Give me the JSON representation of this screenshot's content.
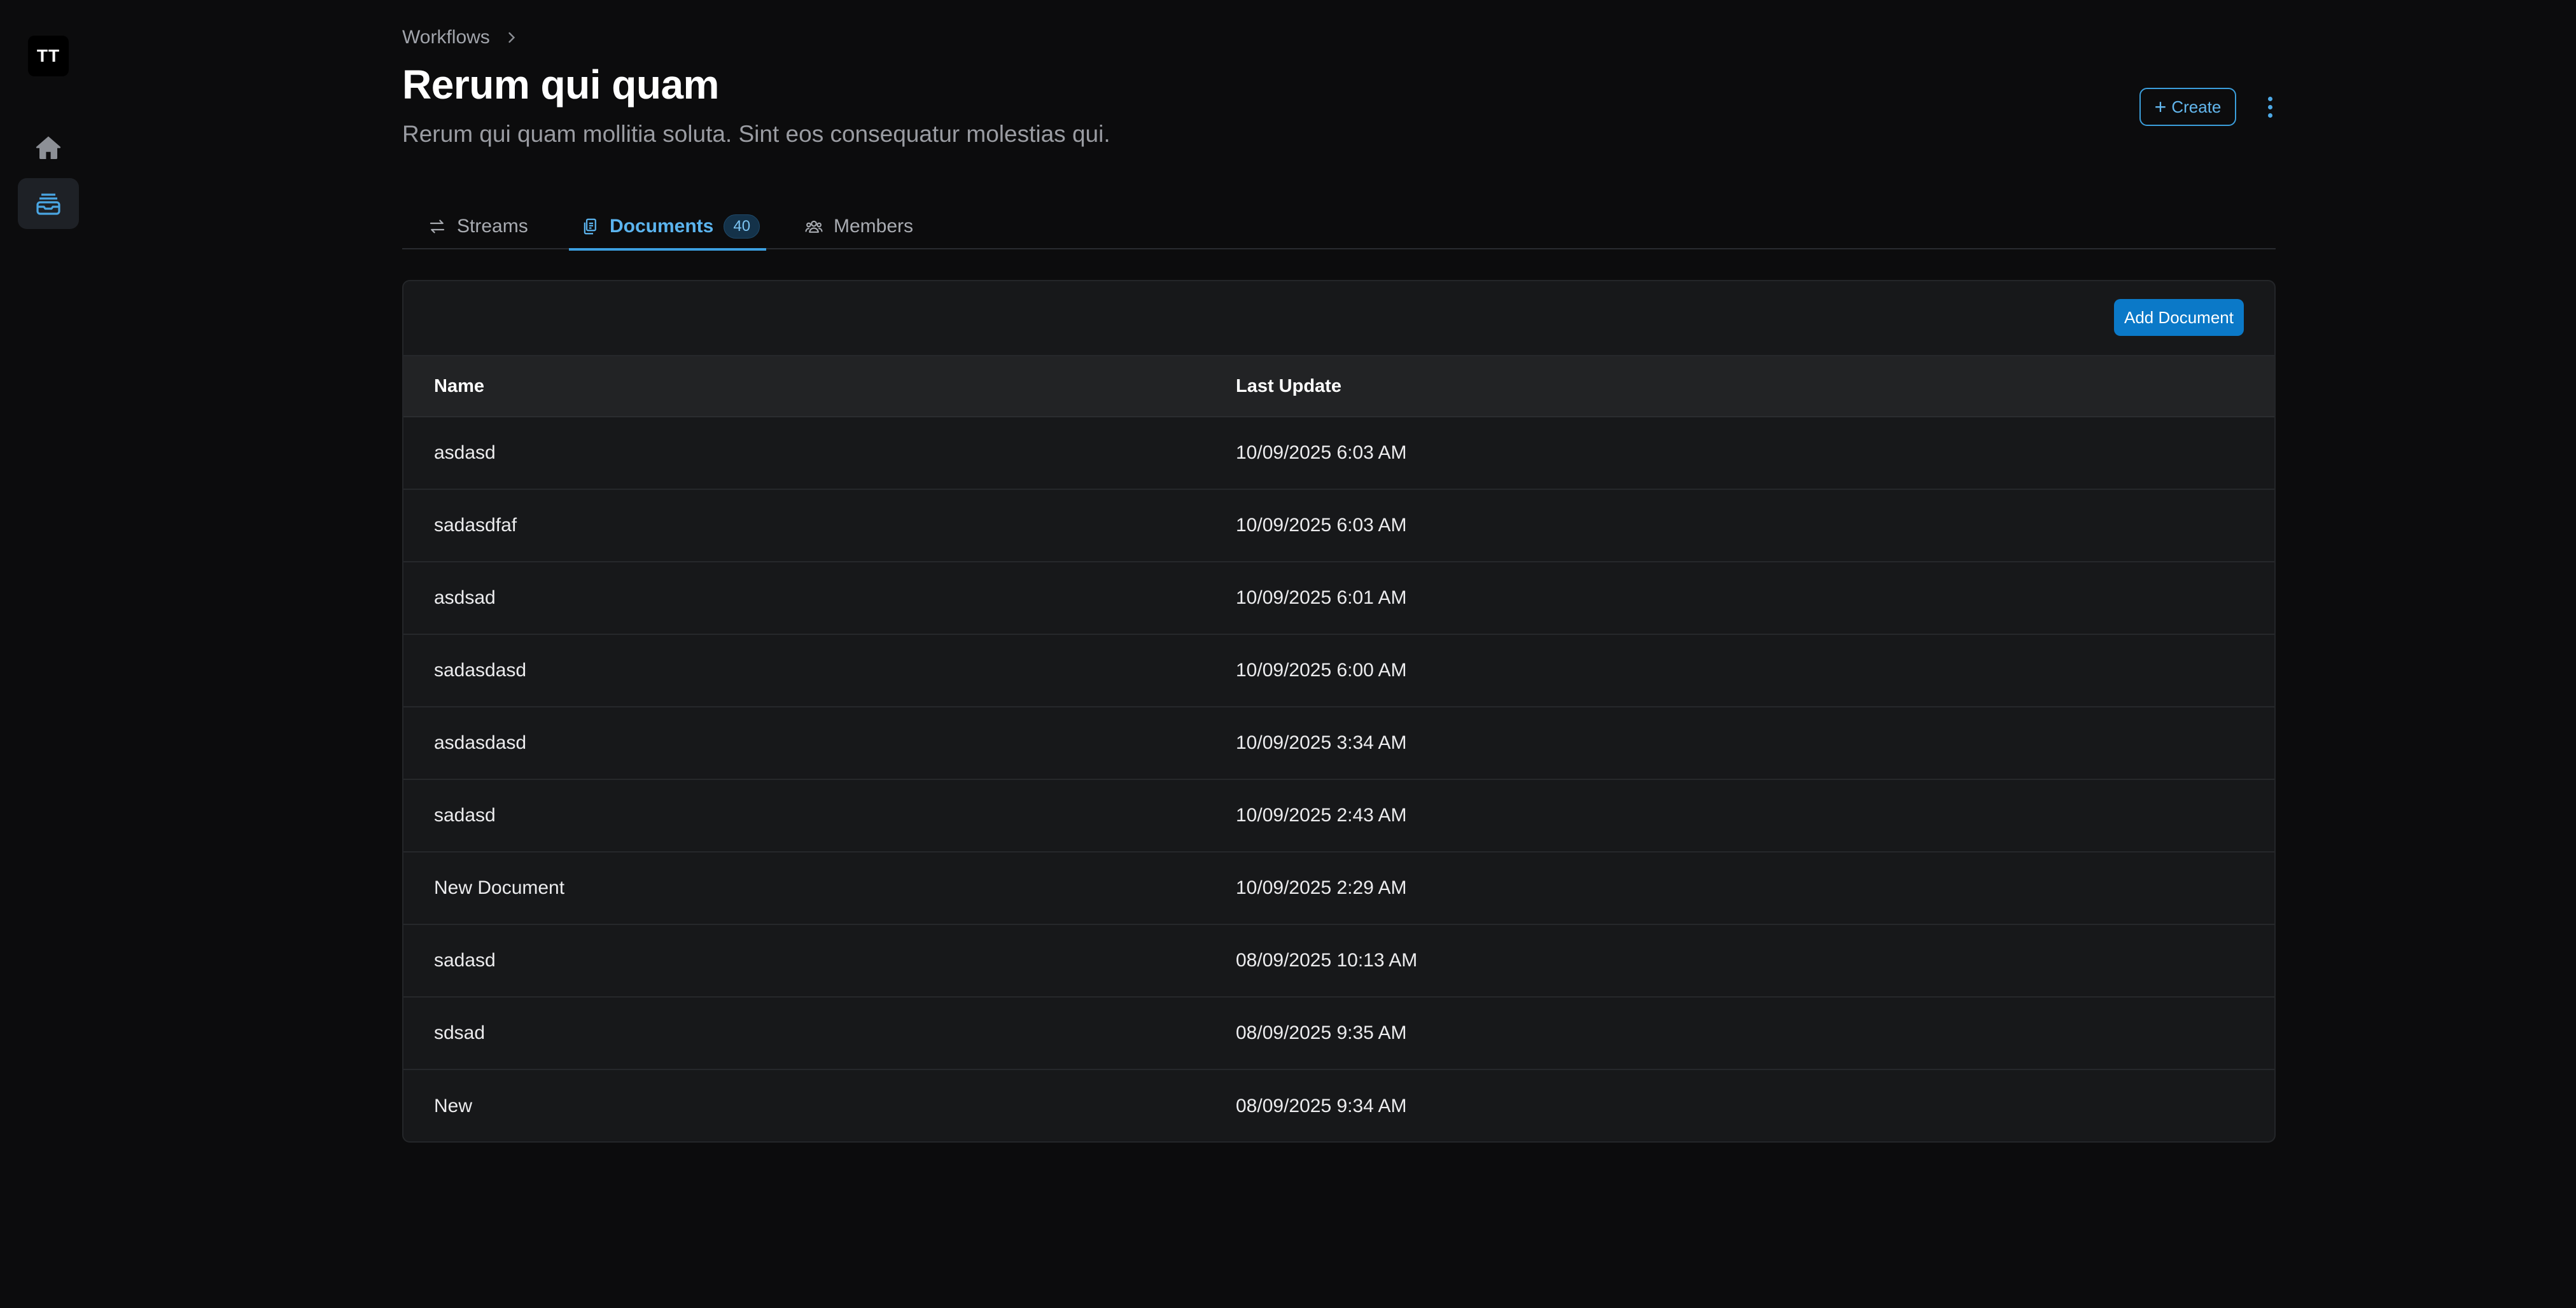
{
  "sidebar": {
    "avatar_initials": "TT",
    "items": [
      {
        "name": "home",
        "icon": "home-icon"
      },
      {
        "name": "documents",
        "icon": "inbox-stack-icon",
        "active": true
      }
    ]
  },
  "breadcrumb": {
    "items": [
      "Workflows"
    ]
  },
  "header": {
    "title": "Rerum qui quam",
    "subtitle": "Rerum qui quam mollitia soluta. Sint eos consequatur molestias qui.",
    "create_label": "Create"
  },
  "tabs": [
    {
      "label": "Streams",
      "icon": "arrows-right-left-icon"
    },
    {
      "label": "Documents",
      "icon": "documents-icon",
      "count": "40",
      "active": true
    },
    {
      "label": "Members",
      "icon": "users-icon"
    }
  ],
  "table": {
    "add_button_label": "Add Document",
    "columns": [
      "Name",
      "Last Update"
    ],
    "rows": [
      {
        "name": "asdasd",
        "last_update": "10/09/2025 6:03 AM"
      },
      {
        "name": "sadasdfaf",
        "last_update": "10/09/2025 6:03 AM"
      },
      {
        "name": "asdsad",
        "last_update": "10/09/2025 6:01 AM"
      },
      {
        "name": "sadasdasd",
        "last_update": "10/09/2025 6:00 AM"
      },
      {
        "name": "asdasdasd",
        "last_update": "10/09/2025 3:34 AM"
      },
      {
        "name": "sadasd",
        "last_update": "10/09/2025 2:43 AM"
      },
      {
        "name": "New Document",
        "last_update": "10/09/2025 2:29 AM"
      },
      {
        "name": "sadasd",
        "last_update": "08/09/2025 10:13 AM"
      },
      {
        "name": "sdsad",
        "last_update": "08/09/2025 9:35 AM"
      },
      {
        "name": "New",
        "last_update": "08/09/2025 9:34 AM"
      }
    ]
  },
  "colors": {
    "background": "#0c0c0d",
    "accent": "#3c9fe0",
    "primary_button": "#0b79c8",
    "card": "#17181a"
  }
}
